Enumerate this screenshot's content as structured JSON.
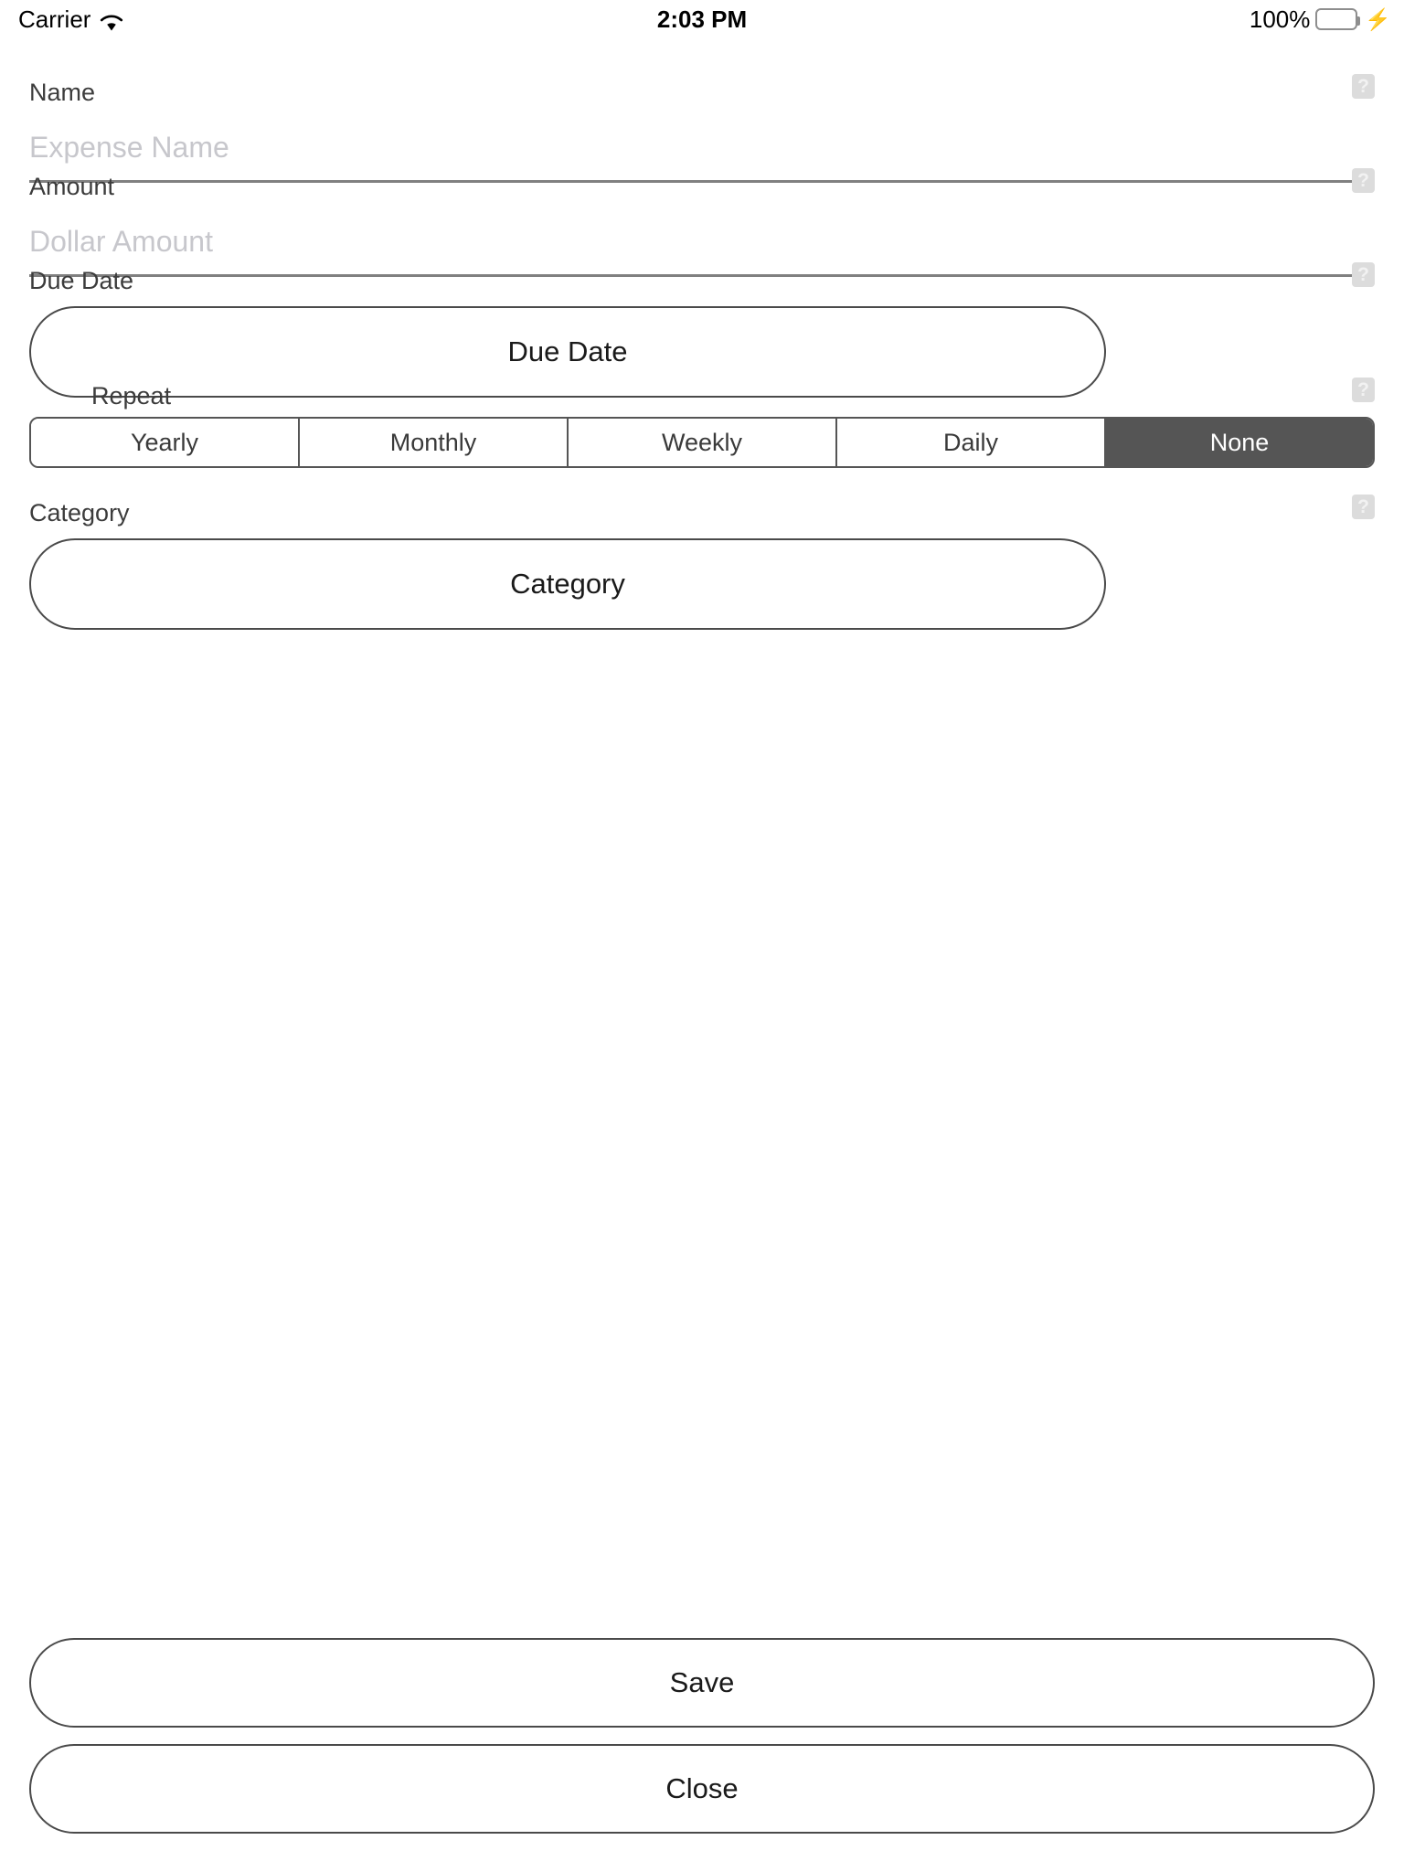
{
  "status_bar": {
    "carrier": "Carrier",
    "wifi_icon": "wifi-icon",
    "time": "2:03 PM",
    "battery_percent": "100%",
    "battery_icon": "battery-full-icon",
    "charging_icon": "lightning-bolt-icon",
    "battery_color": "#4cd964"
  },
  "form": {
    "name": {
      "label": "Name",
      "placeholder": "Expense Name",
      "value": "",
      "help_icon": "?"
    },
    "amount": {
      "label": "Amount",
      "placeholder": "Dollar Amount",
      "value": "",
      "help_icon": "?"
    },
    "due_date": {
      "label": "Due Date",
      "button_label": "Due Date",
      "help_icon": "?"
    },
    "repeat": {
      "label": "Repeat",
      "help_icon": "?",
      "options": [
        "Yearly",
        "Monthly",
        "Weekly",
        "Daily",
        "None"
      ],
      "selected": "None",
      "selected_bg": "#555555",
      "selected_fg": "#ffffff"
    },
    "category": {
      "label": "Category",
      "button_label": "Category",
      "help_icon": "?"
    }
  },
  "actions": {
    "save_label": "Save",
    "close_label": "Close"
  }
}
